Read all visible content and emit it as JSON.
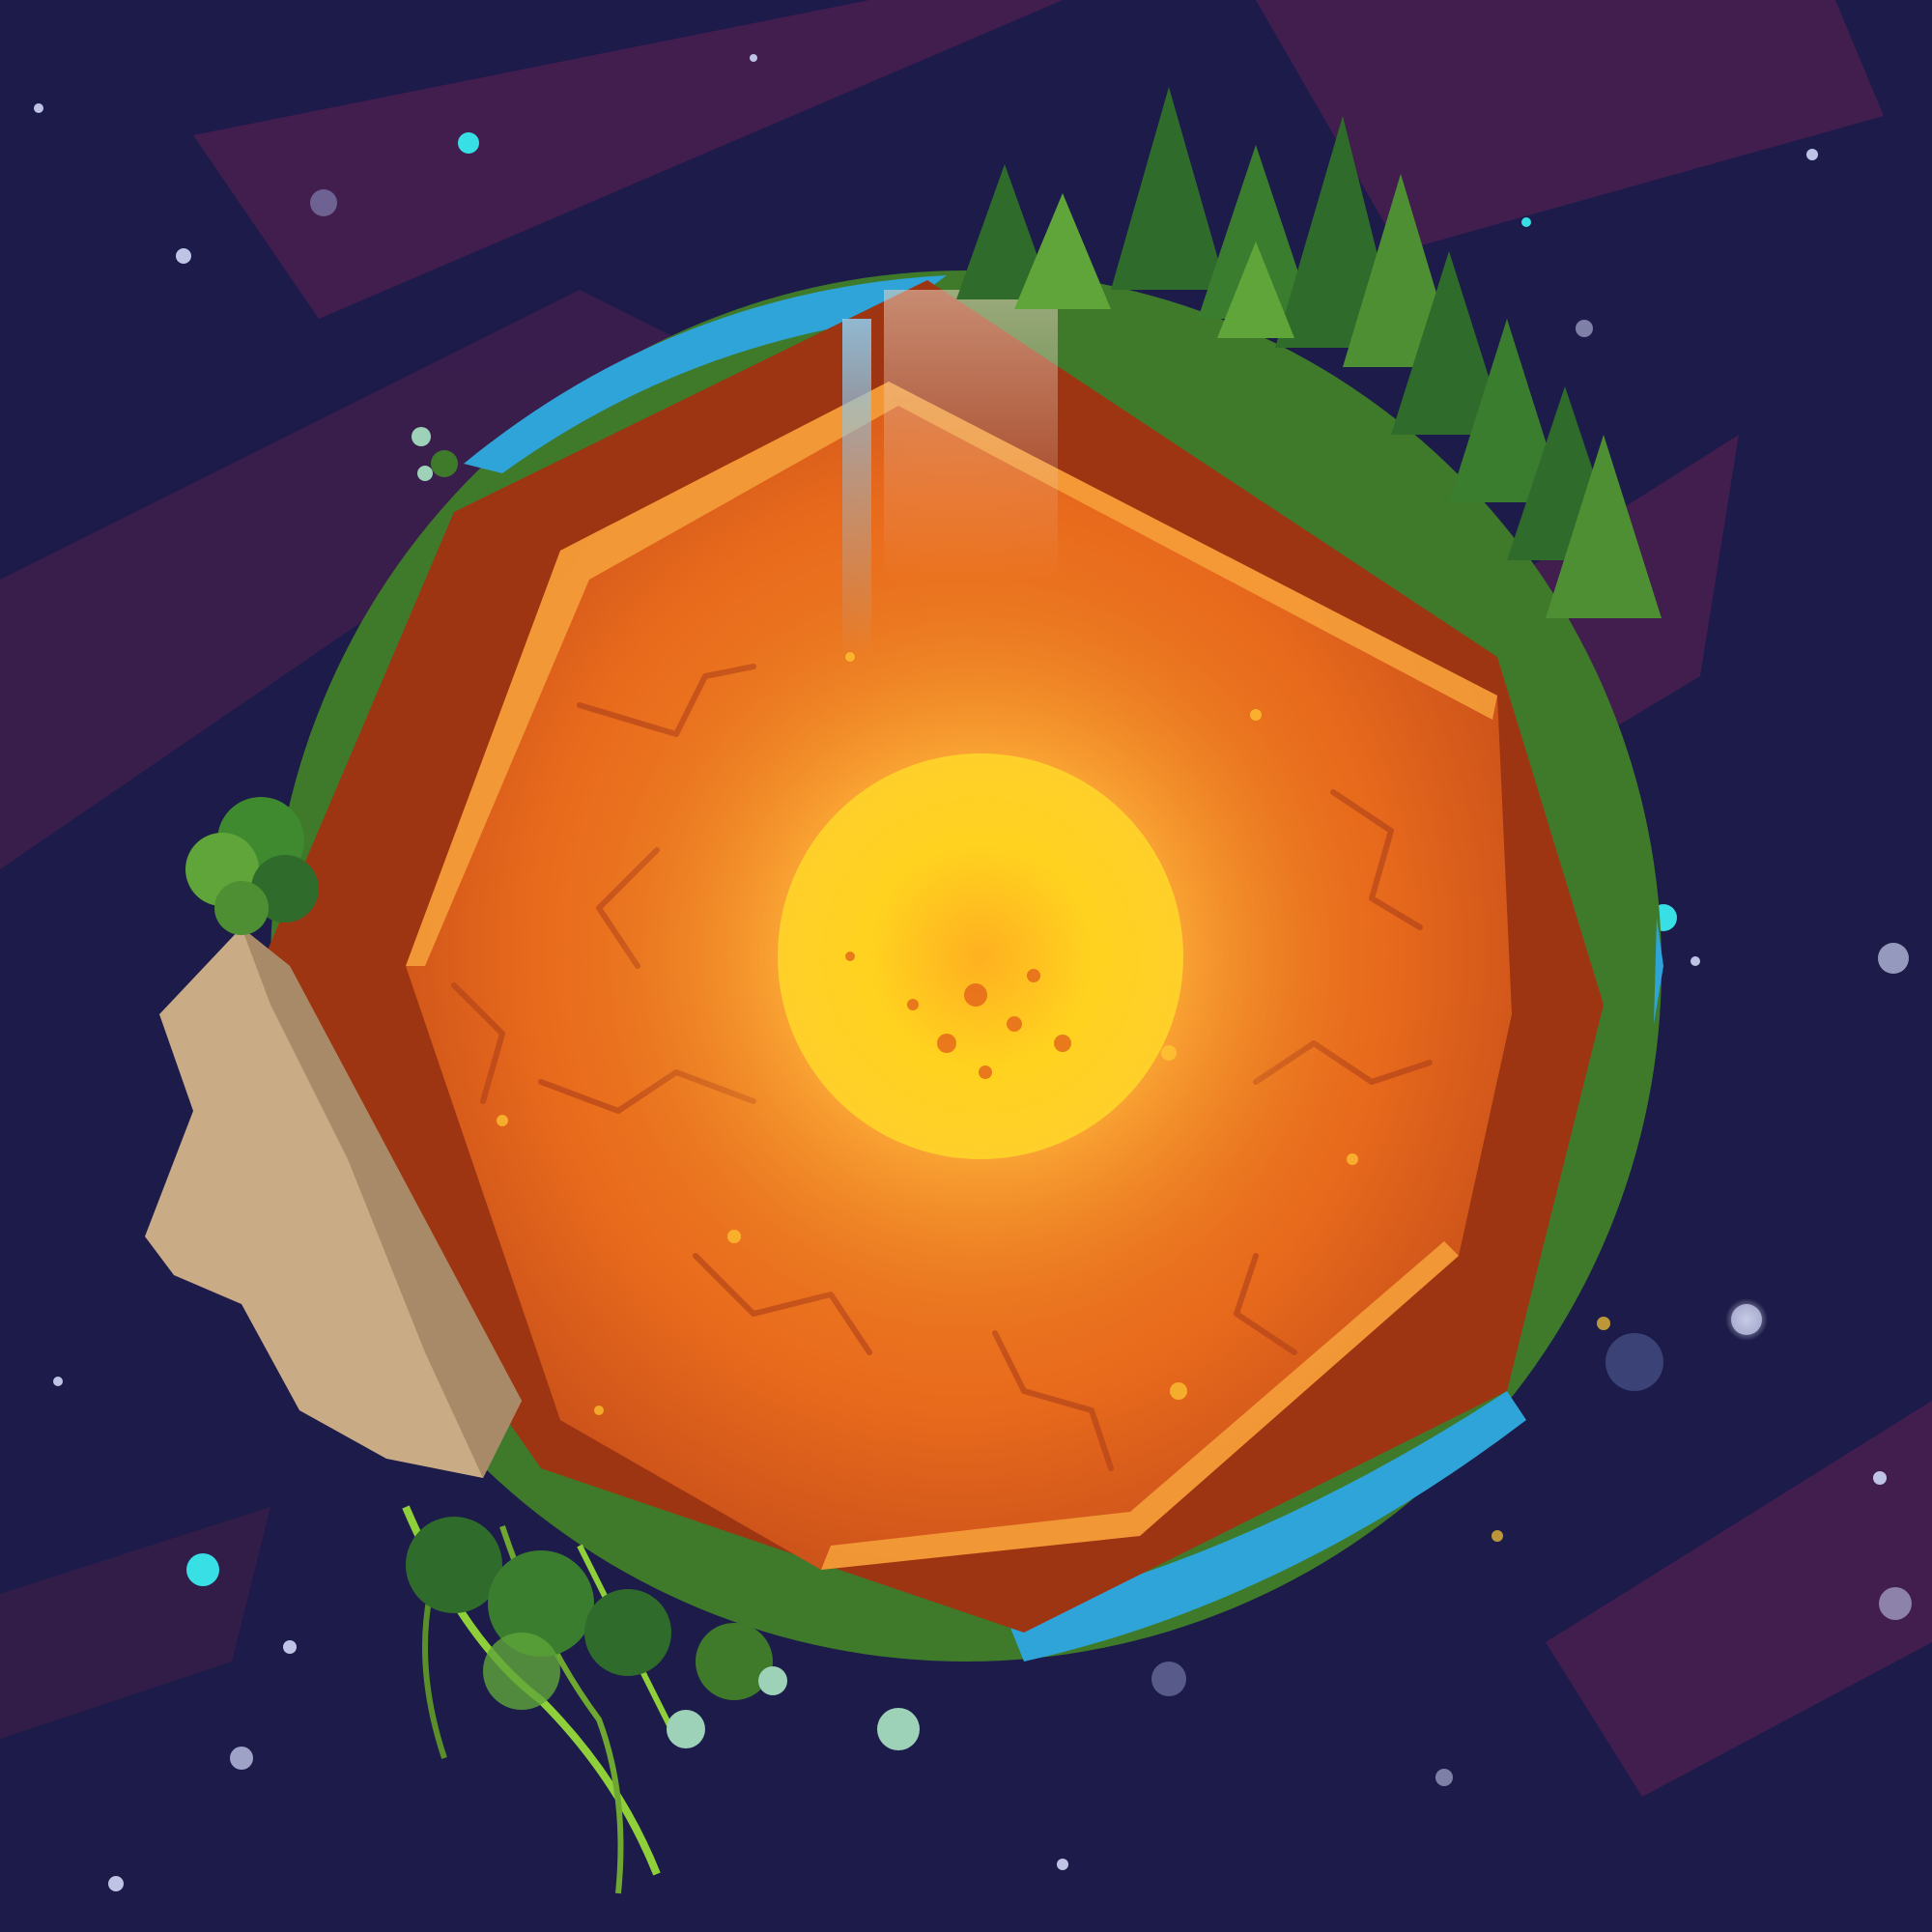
{
  "scene": {
    "subject": "earth-cross-section-illustration",
    "colors": {
      "space": "#1c1b4a",
      "space_streak": "#5a2350",
      "crust_outer": "#9e3512",
      "mantle": "#e0661a",
      "mantle_highlight": "#f7a23b",
      "outer_core": "#ff8c1a",
      "inner_core": "#ffd21f",
      "core_glow": "#ffe97a",
      "grass": "#3f7a2a",
      "forest": "#2f6b2a",
      "forest_light": "#5fa53a",
      "ocean": "#2fa4d8",
      "cliff": "#c9ab86",
      "roots": "#8fcf3a",
      "star": "#bfc4e6",
      "star_cyan": "#38e0e6"
    }
  }
}
